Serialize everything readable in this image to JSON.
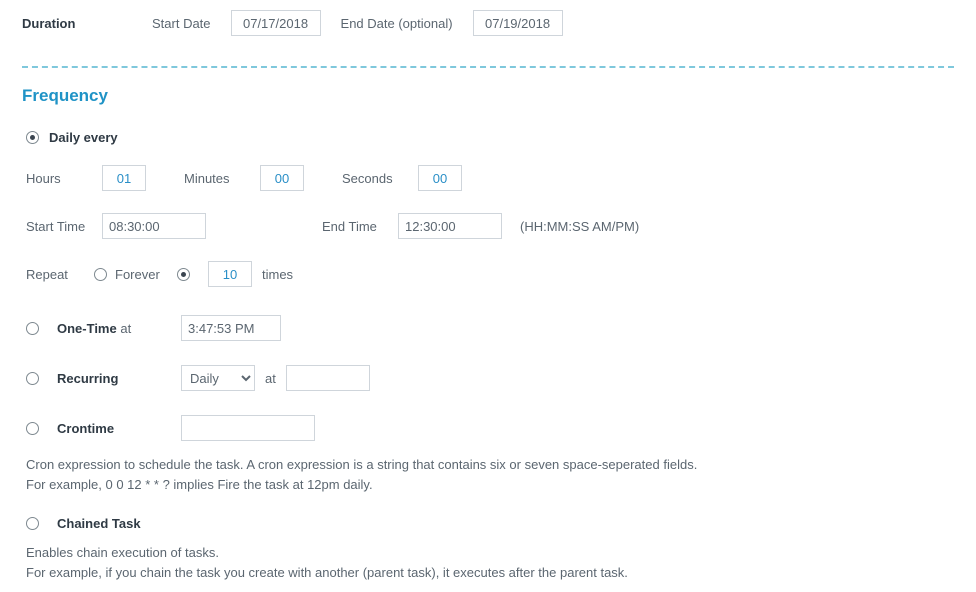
{
  "duration": {
    "label": "Duration",
    "start_label": "Start Date",
    "start_value": "07/17/2018",
    "end_label": "End Date (optional)",
    "end_value": "07/19/2018"
  },
  "frequency": {
    "title": "Frequency",
    "daily": {
      "label": "Daily every",
      "hours_label": "Hours",
      "hours_value": "01",
      "minutes_label": "Minutes",
      "minutes_value": "00",
      "seconds_label": "Seconds",
      "seconds_value": "00",
      "start_time_label": "Start Time",
      "start_time_value": "08:30:00",
      "end_time_label": "End Time",
      "end_time_value": "12:30:00",
      "time_hint": "(HH:MM:SS AM/PM)",
      "repeat_label": "Repeat",
      "forever_label": "Forever",
      "count_value": "10",
      "times_label": "times"
    },
    "onetime": {
      "label": "One-Time",
      "at": "at",
      "value": "3:47:53 PM"
    },
    "recurring": {
      "label": "Recurring",
      "select_value": "Daily",
      "at": "at",
      "value": ""
    },
    "crontime": {
      "label": "Crontime",
      "value": "",
      "help1": "Cron expression to schedule the task. A cron expression is a string that contains six or seven space-seperated fields.",
      "help2": "For example, 0 0 12 * * ? implies Fire the task at 12pm daily."
    },
    "chained": {
      "label": "Chained Task",
      "help1": "Enables chain execution of tasks.",
      "help2": "For example, if you chain the task you create with another (parent task), it executes after the parent task."
    }
  }
}
